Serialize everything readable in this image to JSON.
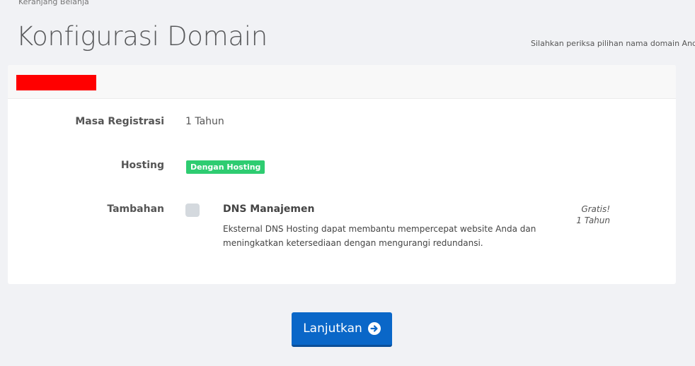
{
  "breadcrumb": "Keranjang Belanja",
  "page": {
    "title": "Konfigurasi Domain",
    "subtitle": "Silahkan periksa pilihan nama domain Anda"
  },
  "domain": {
    "redacted_color": "#ff0000"
  },
  "fields": {
    "registration_label": "Masa Registrasi",
    "registration_value": "1 Tahun",
    "hosting_label": "Hosting",
    "hosting_badge": "Dengan Hosting",
    "addons_label": "Tambahan"
  },
  "addon": {
    "checked": false,
    "title": "DNS Manajemen",
    "description": "Eksternal DNS Hosting dapat membantu mempercepat website Anda dan meningkatkan ketersediaan dengan mengurangi redundansi.",
    "price_line1": "Gratis!",
    "price_line2": "1 Tahun"
  },
  "actions": {
    "continue_label": "Lanjutkan",
    "continue_icon": "arrow-circle-right-icon"
  },
  "colors": {
    "accent": "#0a67c8",
    "badge": "#2ecc71"
  }
}
